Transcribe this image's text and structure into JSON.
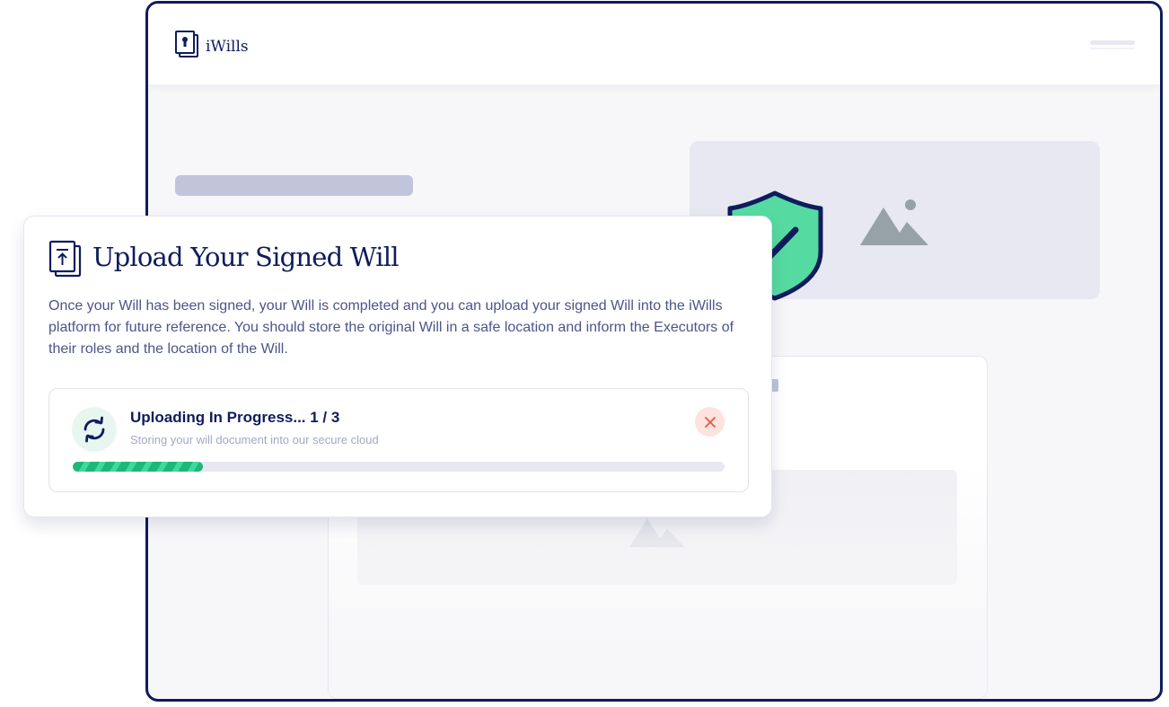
{
  "app": {
    "logo_text": "iWills",
    "logo_icon": "lock-document-icon",
    "menu_icon": "hamburger-menu-icon"
  },
  "upload_card": {
    "icon": "upload-document-icon",
    "title": "Upload Your Signed Will",
    "description": "Once your Will has been signed, your Will is completed and you can upload your signed Will into the iWills platform for future reference. You should store the original Will in a safe location and inform the Executors of their roles and the location of the Will.",
    "progress": {
      "status_icon": "sync-icon",
      "title": "Uploading In Progress... 1 / 3",
      "subtitle": "Storing your will document into our secure cloud",
      "cancel_icon": "close-icon",
      "fraction": 0.2
    }
  },
  "security_badge": {
    "icon": "shield-check-icon"
  },
  "placeholders": {
    "image_icon": "image-mountain-icon"
  },
  "colors": {
    "brand_navy": "#0f1c5c",
    "accent_green": "#1fb67a",
    "shield_green": "#55dba1",
    "cancel_red": "#e8574a"
  }
}
